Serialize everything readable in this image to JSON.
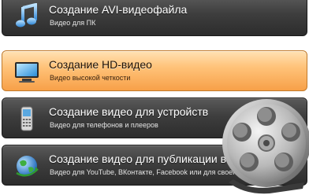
{
  "menu": {
    "items": [
      {
        "title": "Создание AVI-видеофайла",
        "subtitle": "Видео для ПК",
        "icon": "music-note-icon",
        "active": false
      },
      {
        "title": "Создание HD-видео",
        "subtitle": "Видео высокой четкости",
        "icon": "monitor-icon",
        "active": true
      },
      {
        "title": "Создание видео для устройств",
        "subtitle": "Видео для телефонов и плееров",
        "icon": "phone-icon",
        "active": false
      },
      {
        "title": "Создание видео для публикации в Ин",
        "subtitle": "Видео для YouTube, ВКонтакте, Facebook или для своего",
        "icon": "globe-icon",
        "active": false
      }
    ]
  },
  "decoration": {
    "icon": "film-reel-icon"
  },
  "colors": {
    "item_bg": "#3e3e3e",
    "active_bg": "#ffc37a",
    "title_text": "#ffffff",
    "active_title_text": "#1e1206"
  }
}
